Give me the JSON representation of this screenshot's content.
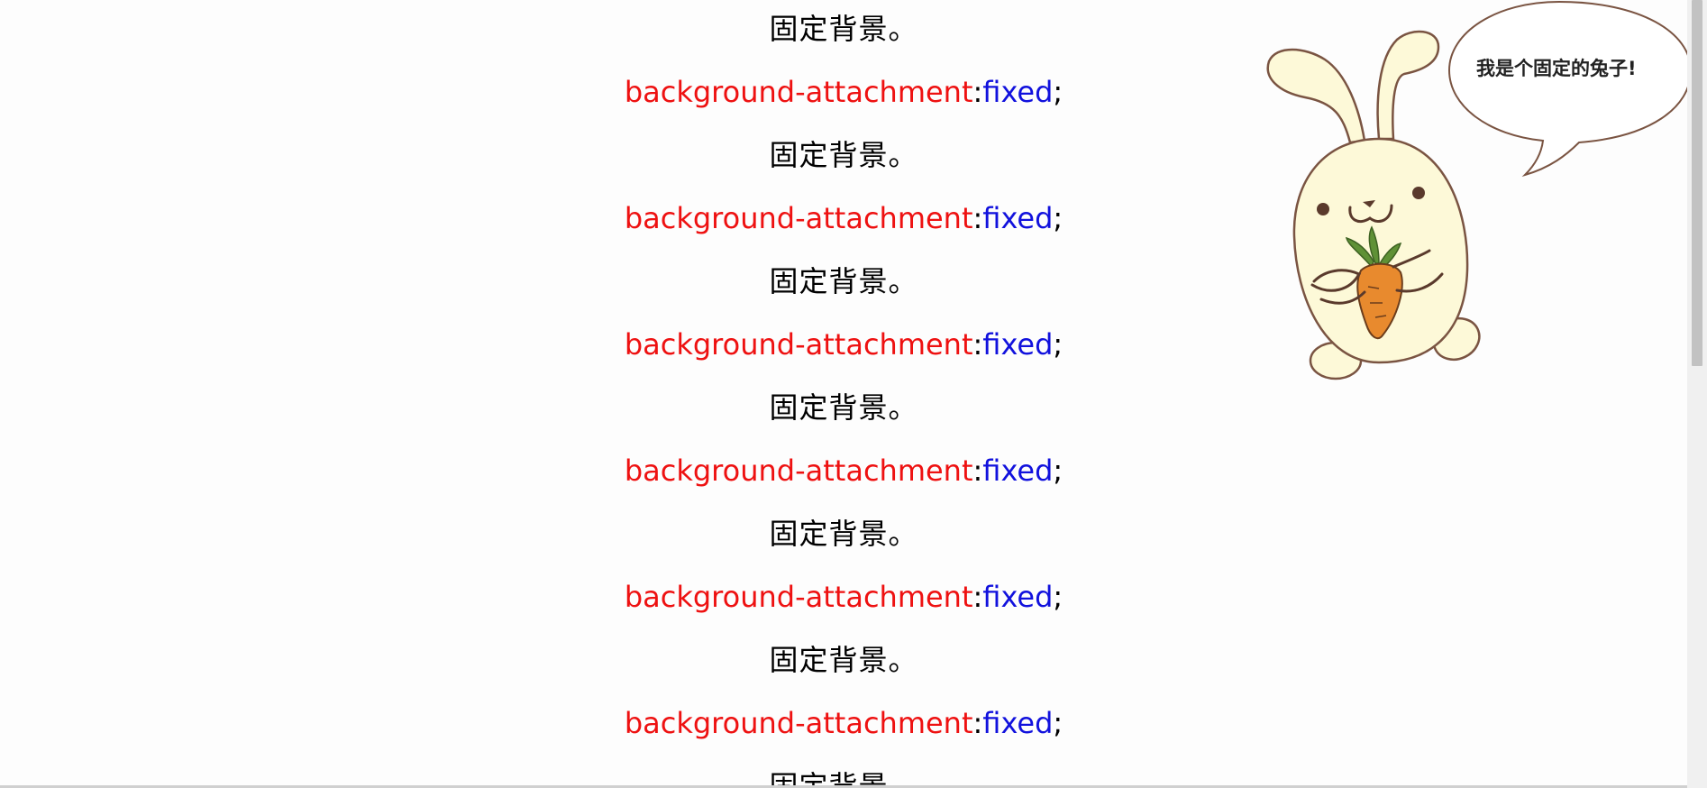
{
  "content": {
    "chinese_label": "固定背景。",
    "css_property": "background-attachment",
    "css_colon": ":",
    "css_value": "fixed",
    "css_semicolon": ";"
  },
  "rabbit": {
    "icon": "rabbit-holding-carrot-icon",
    "speech_bubble_text": "我是个固定的兔子!"
  },
  "colors": {
    "property": "#ee1111",
    "value": "#1111dd",
    "text": "#000000",
    "rabbit_body": "#fdf9d8",
    "rabbit_outline": "#7a5442",
    "carrot": "#e88a2e",
    "carrot_leaf": "#5f9136"
  }
}
